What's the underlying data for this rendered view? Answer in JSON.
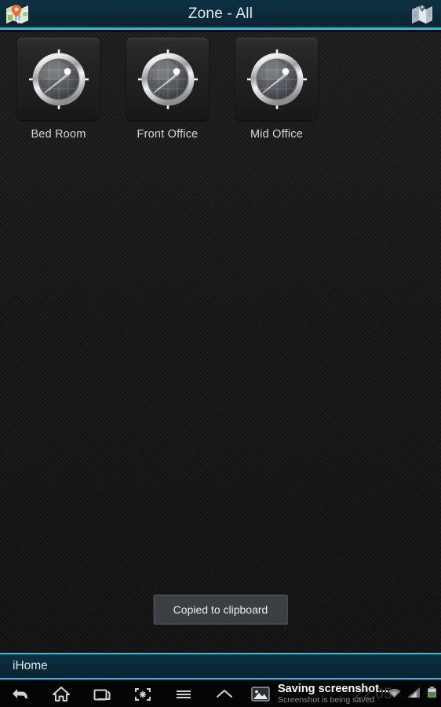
{
  "titlebar": {
    "title": "Zone - All",
    "left_icon": "map-pin-icon",
    "right_icon": "folded-map-icon",
    "bg_color": "#0c2c3c",
    "accent_color": "#37b6e0",
    "title_color": "#e2eaee"
  },
  "main": {
    "background_color": "#161616",
    "devices": [
      {
        "label": "Bed Room",
        "icon": "radar-sensor-icon"
      },
      {
        "label": "Front Office",
        "icon": "radar-sensor-icon"
      },
      {
        "label": "Mid Office",
        "icon": "radar-sensor-icon"
      }
    ]
  },
  "toast": {
    "message": "Copied to clipboard",
    "bg_color": "#3e4348"
  },
  "ihome_bar": {
    "label": "iHome",
    "bg_color": "#0b2a39",
    "accent_color": "#37b6e0"
  },
  "navbar": {
    "buttons": [
      {
        "name": "back-icon",
        "label": "Back"
      },
      {
        "name": "home-icon",
        "label": "Home"
      },
      {
        "name": "recents-icon",
        "label": "Recent apps"
      },
      {
        "name": "screenshot-icon",
        "label": "Screenshot"
      },
      {
        "name": "menu-icon",
        "label": "Menu"
      },
      {
        "name": "chevron-up-icon",
        "label": "Expand"
      }
    ]
  },
  "notification": {
    "icon": "image-icon",
    "title": "Saving screenshot...",
    "subtitle": "Screenshot is being saved"
  },
  "statusbar": {
    "clock": "22:05",
    "icons": [
      "wifi-icon",
      "signal-bars-icon",
      "battery-icon"
    ]
  }
}
